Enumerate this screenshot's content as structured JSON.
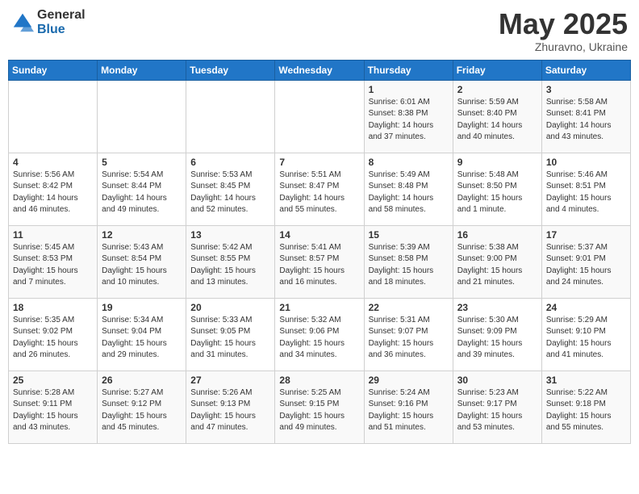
{
  "logo": {
    "general": "General",
    "blue": "Blue"
  },
  "title": "May 2025",
  "location": "Zhuravno, Ukraine",
  "headers": [
    "Sunday",
    "Monday",
    "Tuesday",
    "Wednesday",
    "Thursday",
    "Friday",
    "Saturday"
  ],
  "weeks": [
    [
      {
        "day": "",
        "info": ""
      },
      {
        "day": "",
        "info": ""
      },
      {
        "day": "",
        "info": ""
      },
      {
        "day": "",
        "info": ""
      },
      {
        "day": "1",
        "info": "Sunrise: 6:01 AM\nSunset: 8:38 PM\nDaylight: 14 hours\nand 37 minutes."
      },
      {
        "day": "2",
        "info": "Sunrise: 5:59 AM\nSunset: 8:40 PM\nDaylight: 14 hours\nand 40 minutes."
      },
      {
        "day": "3",
        "info": "Sunrise: 5:58 AM\nSunset: 8:41 PM\nDaylight: 14 hours\nand 43 minutes."
      }
    ],
    [
      {
        "day": "4",
        "info": "Sunrise: 5:56 AM\nSunset: 8:42 PM\nDaylight: 14 hours\nand 46 minutes."
      },
      {
        "day": "5",
        "info": "Sunrise: 5:54 AM\nSunset: 8:44 PM\nDaylight: 14 hours\nand 49 minutes."
      },
      {
        "day": "6",
        "info": "Sunrise: 5:53 AM\nSunset: 8:45 PM\nDaylight: 14 hours\nand 52 minutes."
      },
      {
        "day": "7",
        "info": "Sunrise: 5:51 AM\nSunset: 8:47 PM\nDaylight: 14 hours\nand 55 minutes."
      },
      {
        "day": "8",
        "info": "Sunrise: 5:49 AM\nSunset: 8:48 PM\nDaylight: 14 hours\nand 58 minutes."
      },
      {
        "day": "9",
        "info": "Sunrise: 5:48 AM\nSunset: 8:50 PM\nDaylight: 15 hours\nand 1 minute."
      },
      {
        "day": "10",
        "info": "Sunrise: 5:46 AM\nSunset: 8:51 PM\nDaylight: 15 hours\nand 4 minutes."
      }
    ],
    [
      {
        "day": "11",
        "info": "Sunrise: 5:45 AM\nSunset: 8:53 PM\nDaylight: 15 hours\nand 7 minutes."
      },
      {
        "day": "12",
        "info": "Sunrise: 5:43 AM\nSunset: 8:54 PM\nDaylight: 15 hours\nand 10 minutes."
      },
      {
        "day": "13",
        "info": "Sunrise: 5:42 AM\nSunset: 8:55 PM\nDaylight: 15 hours\nand 13 minutes."
      },
      {
        "day": "14",
        "info": "Sunrise: 5:41 AM\nSunset: 8:57 PM\nDaylight: 15 hours\nand 16 minutes."
      },
      {
        "day": "15",
        "info": "Sunrise: 5:39 AM\nSunset: 8:58 PM\nDaylight: 15 hours\nand 18 minutes."
      },
      {
        "day": "16",
        "info": "Sunrise: 5:38 AM\nSunset: 9:00 PM\nDaylight: 15 hours\nand 21 minutes."
      },
      {
        "day": "17",
        "info": "Sunrise: 5:37 AM\nSunset: 9:01 PM\nDaylight: 15 hours\nand 24 minutes."
      }
    ],
    [
      {
        "day": "18",
        "info": "Sunrise: 5:35 AM\nSunset: 9:02 PM\nDaylight: 15 hours\nand 26 minutes."
      },
      {
        "day": "19",
        "info": "Sunrise: 5:34 AM\nSunset: 9:04 PM\nDaylight: 15 hours\nand 29 minutes."
      },
      {
        "day": "20",
        "info": "Sunrise: 5:33 AM\nSunset: 9:05 PM\nDaylight: 15 hours\nand 31 minutes."
      },
      {
        "day": "21",
        "info": "Sunrise: 5:32 AM\nSunset: 9:06 PM\nDaylight: 15 hours\nand 34 minutes."
      },
      {
        "day": "22",
        "info": "Sunrise: 5:31 AM\nSunset: 9:07 PM\nDaylight: 15 hours\nand 36 minutes."
      },
      {
        "day": "23",
        "info": "Sunrise: 5:30 AM\nSunset: 9:09 PM\nDaylight: 15 hours\nand 39 minutes."
      },
      {
        "day": "24",
        "info": "Sunrise: 5:29 AM\nSunset: 9:10 PM\nDaylight: 15 hours\nand 41 minutes."
      }
    ],
    [
      {
        "day": "25",
        "info": "Sunrise: 5:28 AM\nSunset: 9:11 PM\nDaylight: 15 hours\nand 43 minutes."
      },
      {
        "day": "26",
        "info": "Sunrise: 5:27 AM\nSunset: 9:12 PM\nDaylight: 15 hours\nand 45 minutes."
      },
      {
        "day": "27",
        "info": "Sunrise: 5:26 AM\nSunset: 9:13 PM\nDaylight: 15 hours\nand 47 minutes."
      },
      {
        "day": "28",
        "info": "Sunrise: 5:25 AM\nSunset: 9:15 PM\nDaylight: 15 hours\nand 49 minutes."
      },
      {
        "day": "29",
        "info": "Sunrise: 5:24 AM\nSunset: 9:16 PM\nDaylight: 15 hours\nand 51 minutes."
      },
      {
        "day": "30",
        "info": "Sunrise: 5:23 AM\nSunset: 9:17 PM\nDaylight: 15 hours\nand 53 minutes."
      },
      {
        "day": "31",
        "info": "Sunrise: 5:22 AM\nSunset: 9:18 PM\nDaylight: 15 hours\nand 55 minutes."
      }
    ]
  ]
}
